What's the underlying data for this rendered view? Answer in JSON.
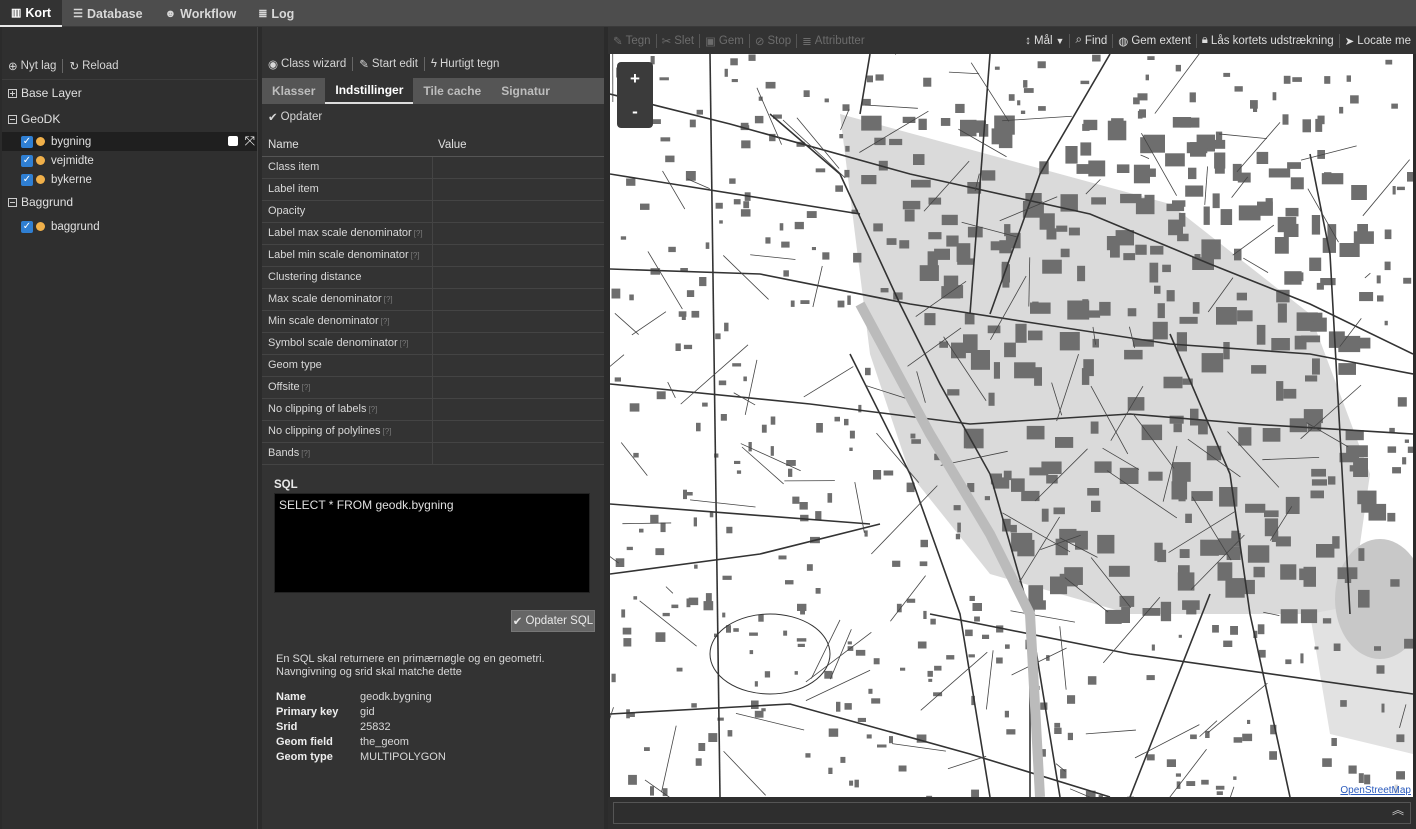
{
  "topnav": {
    "tabs": [
      {
        "label": "Kort",
        "icon": "map-icon"
      },
      {
        "label": "Database",
        "icon": "database-icon"
      },
      {
        "label": "Workflow",
        "icon": "users-icon"
      },
      {
        "label": "Log",
        "icon": "list-icon"
      }
    ]
  },
  "layers": {
    "new_layer": "Nyt lag",
    "reload": "Reload",
    "groups": [
      {
        "label": "Base Layer",
        "expanded": false,
        "items": []
      },
      {
        "label": "GeoDK",
        "expanded": true,
        "items": [
          {
            "label": "bygning",
            "checked": true,
            "selected": true
          },
          {
            "label": "vejmidte",
            "checked": true
          },
          {
            "label": "bykerne",
            "checked": true
          }
        ]
      },
      {
        "label": "Baggrund",
        "expanded": true,
        "items": [
          {
            "label": "baggrund",
            "checked": true
          }
        ]
      }
    ]
  },
  "editor": {
    "toolbar": {
      "class_wizard": "Class wizard",
      "start_edit": "Start edit",
      "quick_draw": "Hurtigt tegn"
    },
    "tabs": [
      "Klasser",
      "Indstillinger",
      "Tile cache",
      "Signatur"
    ],
    "active_tab": "Indstillinger",
    "update": "Opdater",
    "table": {
      "col_name": "Name",
      "col_value": "Value",
      "rows": [
        {
          "name": "Class item",
          "hint": ""
        },
        {
          "name": "Label item",
          "hint": ""
        },
        {
          "name": "Opacity",
          "hint": ""
        },
        {
          "name": "Label max scale denominator",
          "hint": "[?]"
        },
        {
          "name": "Label min scale denominator",
          "hint": "[?]"
        },
        {
          "name": "Clustering distance",
          "hint": ""
        },
        {
          "name": "Max scale denominator",
          "hint": "[?]"
        },
        {
          "name": "Min scale denominator",
          "hint": "[?]"
        },
        {
          "name": "Symbol scale denominator",
          "hint": "[?]"
        },
        {
          "name": "Geom type",
          "hint": ""
        },
        {
          "name": "Offsite",
          "hint": "[?]"
        },
        {
          "name": "No clipping of labels",
          "hint": "[?]"
        },
        {
          "name": "No clipping of polylines",
          "hint": "[?]"
        },
        {
          "name": "Bands",
          "hint": "[?]"
        }
      ]
    },
    "sql_label": "SQL",
    "sql_value": "SELECT * FROM geodk.bygning",
    "sql_button": "Opdater SQL",
    "sql_note_1": "En SQL skal returnere en primærnøgle og en geometri.",
    "sql_note_2": "Navngivning og srid skal matche dette",
    "meta": [
      {
        "key": "Name",
        "value": "geodk.bygning"
      },
      {
        "key": "Primary key",
        "value": "gid"
      },
      {
        "key": "Srid",
        "value": "25832"
      },
      {
        "key": "Geom field",
        "value": "the_geom"
      },
      {
        "key": "Geom type",
        "value": "MULTIPOLYGON"
      }
    ]
  },
  "maptools": {
    "left": [
      {
        "label": "Tegn",
        "icon": "pencil-icon"
      },
      {
        "label": "Slet",
        "icon": "scissors-icon"
      },
      {
        "label": "Gem",
        "icon": "save-icon"
      },
      {
        "label": "Stop",
        "icon": "stop-icon"
      },
      {
        "label": "Attributter",
        "icon": "list-icon"
      }
    ],
    "right": [
      {
        "label": "Mål",
        "icon": "measure-icon"
      },
      {
        "label": "Find",
        "icon": "search-icon"
      },
      {
        "label": "Gem extent",
        "icon": "globe-icon"
      },
      {
        "label": "Lås kortets udstrækning",
        "icon": "lock-icon"
      },
      {
        "label": "Locate me",
        "icon": "locate-icon"
      }
    ]
  },
  "map": {
    "zoom_in": "+",
    "zoom_out": "-",
    "attribution": "OpenStreetMap"
  }
}
